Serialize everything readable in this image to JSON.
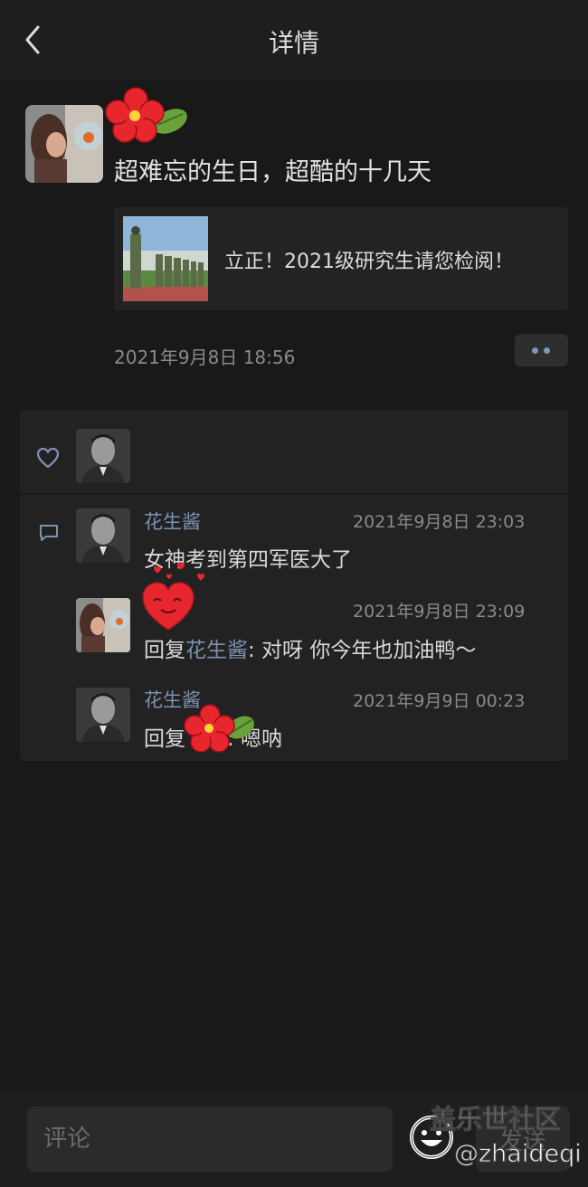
{
  "header": {
    "title": "详情"
  },
  "post": {
    "text": "超难忘的生日，超酷的十几天",
    "link": {
      "title": "立正！2021级研究生请您检阅！"
    },
    "time": "2021年9月8日 18:56"
  },
  "comments": [
    {
      "name": "花生酱",
      "time": "2021年9月8日 23:03",
      "text": "女神考到第四军医大了"
    },
    {
      "name": "",
      "time": "2021年9月8日 23:09",
      "reply_prefix": "回复",
      "reply_to": "花生酱",
      "text": ": 对呀 你今年也加油鸭～"
    },
    {
      "name": "花生酱",
      "time": "2021年9月9日 00:23",
      "reply_prefix": "回复",
      "text": ": 嗯呐"
    }
  ],
  "footer": {
    "input_placeholder": "评论",
    "send_label": "发送"
  },
  "watermark": {
    "title": "盖乐世社区",
    "handle": "@zhaideqi"
  },
  "colors": {
    "background": "#191919",
    "accent_name": "#7d91b1",
    "card": "#222222"
  },
  "icons": [
    "back-arrow-icon",
    "heart-icon",
    "comment-icon",
    "more-dots-icon",
    "flower-sticker",
    "heart-face-sticker"
  ]
}
